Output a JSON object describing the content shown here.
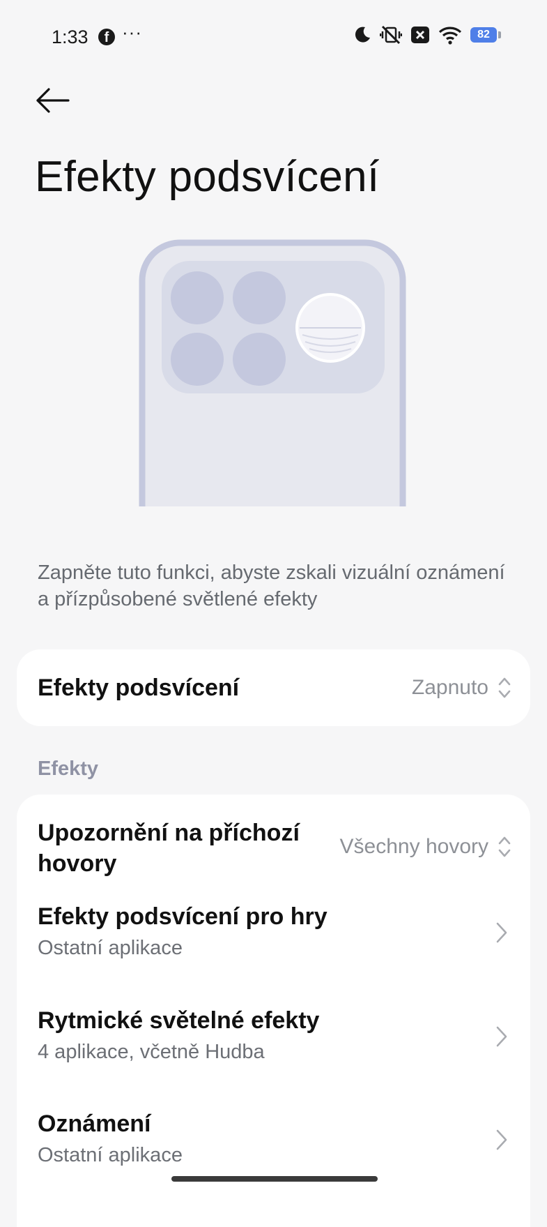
{
  "status_bar": {
    "time": "1:33",
    "more": "···",
    "battery_level": "82",
    "icons": [
      "facebook-icon",
      "moon-icon",
      "vibrate-off-icon",
      "close-box-icon",
      "wifi-icon",
      "battery-icon"
    ]
  },
  "header": {
    "title": "Efekty podsvícení"
  },
  "description": "Zapněte tuto funkci, abyste zskali vizuální oznámení a přízpůsobené světlené efekty",
  "toggle_row": {
    "label": "Efekty podsvícení",
    "value": "Zapnuto"
  },
  "section": {
    "label": "Efekty"
  },
  "rows": [
    {
      "title_line1": "Upozornění na příchozí",
      "title_line2": "hovory",
      "value": "Všechny hovory"
    },
    {
      "title": "Efekty podsvícení pro hry",
      "subtitle": "Ostatní aplikace"
    },
    {
      "title": "Rytmické světelné efekty",
      "subtitle": "4 aplikace, včetně Hudba"
    },
    {
      "title": "Oznámení",
      "subtitle": "Ostatní aplikace"
    }
  ],
  "colors": {
    "background": "#f6f6f7",
    "card": "#ffffff",
    "section_label": "#8f92a4",
    "battery": "#4f7fe8",
    "illustration": "#c4c8de"
  }
}
